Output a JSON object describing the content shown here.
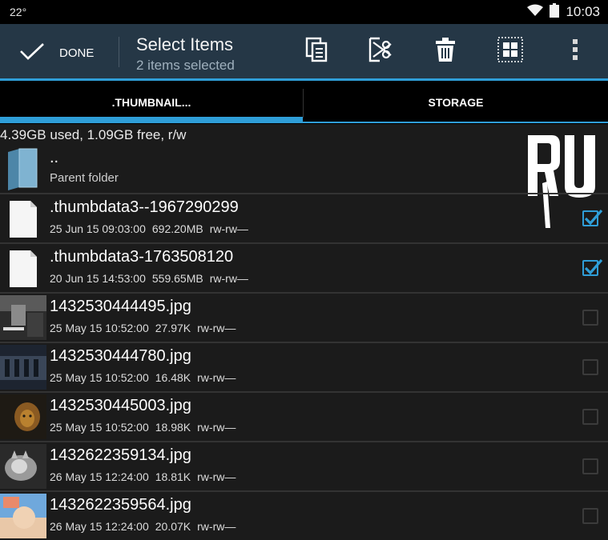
{
  "status_bar": {
    "temperature": "22°",
    "time": "10:03",
    "icons": [
      "wifi-icon",
      "battery-icon"
    ]
  },
  "action_bar": {
    "done_label": "DONE",
    "title": "Select Items",
    "subtitle": "2 items selected",
    "icons": [
      "copy-icon",
      "cut-icon",
      "delete-icon",
      "select-all-icon",
      "overflow-menu-icon"
    ]
  },
  "tabs": [
    {
      "label": ".THUMBNAIL...",
      "active": true
    },
    {
      "label": "STORAGE",
      "active": false
    }
  ],
  "storage_info": "4.39GB used, 1.09GB free, r/w",
  "watermark_text": "RU",
  "parent": {
    "name": "..",
    "label": "Parent folder"
  },
  "files": [
    {
      "name": ".thumbdata3--1967290299",
      "date": "25 Jun 15 09:03:00",
      "size": "692.20MB",
      "perm": "rw-rw—",
      "checked": true,
      "thumb": "doc"
    },
    {
      "name": ".thumbdata3-1763508120",
      "date": "20 Jun 15 14:53:00",
      "size": "559.65MB",
      "perm": "rw-rw—",
      "checked": true,
      "thumb": "doc"
    },
    {
      "name": "1432530444495.jpg",
      "date": "25 May 15 10:52:00",
      "size": "27.97K",
      "perm": "rw-rw—",
      "checked": false,
      "thumb": "photo1"
    },
    {
      "name": "1432530444780.jpg",
      "date": "25 May 15 10:52:00",
      "size": "16.48K",
      "perm": "rw-rw—",
      "checked": false,
      "thumb": "photo2"
    },
    {
      "name": "1432530445003.jpg",
      "date": "25 May 15 10:52:00",
      "size": "18.98K",
      "perm": "rw-rw—",
      "checked": false,
      "thumb": "photo3"
    },
    {
      "name": "1432622359134.jpg",
      "date": "26 May 15 12:24:00",
      "size": "18.81K",
      "perm": "rw-rw—",
      "checked": false,
      "thumb": "photo4"
    },
    {
      "name": "1432622359564.jpg",
      "date": "26 May 15 12:24:00",
      "size": "20.07K",
      "perm": "rw-rw—",
      "checked": false,
      "thumb": "photo5"
    }
  ],
  "colors": {
    "accent": "#2f9ed8",
    "action_bar": "#253746",
    "background": "#1b1b1b"
  }
}
